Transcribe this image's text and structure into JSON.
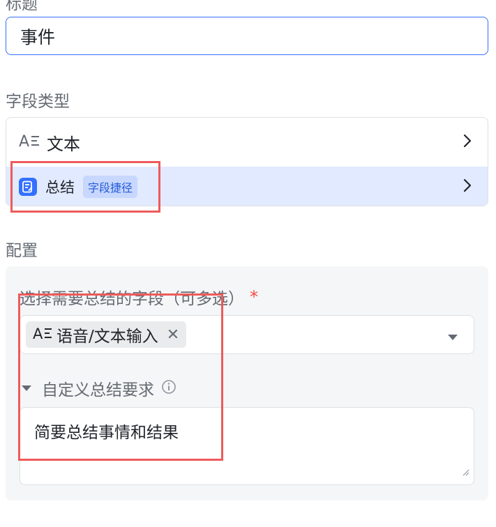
{
  "title_section": {
    "label": "标题",
    "value": "事件"
  },
  "field_type_section": {
    "label": "字段类型",
    "options": [
      {
        "icon": "text-format-icon",
        "label": "文本"
      },
      {
        "icon": "summary-icon",
        "label": "总结",
        "badge": "字段捷径"
      }
    ]
  },
  "config_section": {
    "label": "配置",
    "select_label": "选择需要总结的字段（可多选）",
    "required_mark": "*",
    "selected_tag": {
      "label": "语音/文本输入",
      "close": "✕"
    },
    "custom_label": "自定义总结要求",
    "custom_text": "简要总结事情和结果"
  },
  "colors": {
    "accent": "#3370ff",
    "selected_row_bg": "#e1eaff",
    "badge_bg": "#c7d7fd",
    "highlight_box": "#ee5a5a"
  }
}
